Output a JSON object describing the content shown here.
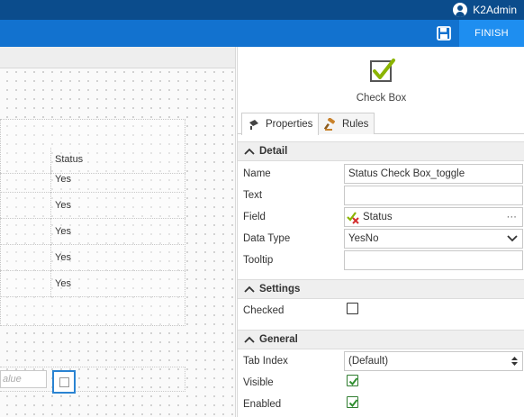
{
  "header": {
    "username": "K2Admin"
  },
  "toolbar": {
    "finish_label": "FINISH"
  },
  "canvas": {
    "grid": {
      "column_header": "Status",
      "rows": [
        "Yes",
        "Yes",
        "Yes",
        "Yes",
        "Yes"
      ]
    },
    "value_input": {
      "placeholder": "alue"
    }
  },
  "panel": {
    "control_title": "Check Box",
    "tabs": [
      {
        "label": "Properties"
      },
      {
        "label": "Rules"
      }
    ],
    "sections": {
      "detail": "Detail",
      "settings": "Settings",
      "general": "General"
    },
    "properties": {
      "name": {
        "label": "Name",
        "value": "Status Check Box_toggle"
      },
      "text": {
        "label": "Text",
        "value": ""
      },
      "field": {
        "label": "Field",
        "value": "Status",
        "more": "···"
      },
      "data_type": {
        "label": "Data Type",
        "value": "YesNo"
      },
      "tooltip": {
        "label": "Tooltip",
        "value": ""
      },
      "checked": {
        "label": "Checked",
        "value": false
      },
      "tab_index": {
        "label": "Tab Index",
        "value": "(Default)"
      },
      "visible": {
        "label": "Visible",
        "value": true
      },
      "enabled": {
        "label": "Enabled",
        "value": true
      }
    }
  },
  "colors": {
    "topbar": "#0b4c8c",
    "toolbar": "#1272cf",
    "finish": "#1e8ef0",
    "checkmark": "#8bb400"
  }
}
